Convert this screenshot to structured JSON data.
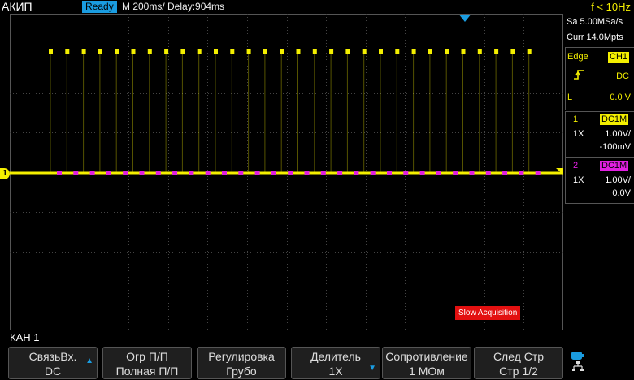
{
  "header": {
    "brand": "АКИП",
    "status": "Ready",
    "timebase": "M 200ms/  Delay:904ms",
    "frequency": "f < 10Hz"
  },
  "acquisition": {
    "sample_rate": "Sa 5.00MSa/s",
    "memory_depth": "Curr 14.0Mpts"
  },
  "trigger": {
    "type": "Edge",
    "source": "CH1",
    "slope_icon": "rising-edge-icon",
    "coupling": "DC",
    "level_label": "L",
    "level": "0.0 V"
  },
  "channels": [
    {
      "num": "1",
      "tag": "DC1M",
      "probe": "1X",
      "scale": "1.00V/",
      "offset": "-100mV",
      "color": "#f4ef00"
    },
    {
      "num": "2",
      "tag": "DC1M",
      "probe": "1X",
      "scale": "1.00V/",
      "offset": "0.0V",
      "color": "#e020e0"
    }
  ],
  "screen": {
    "ch1_marker": "1",
    "slow_acquisition": "Slow Acquisition"
  },
  "menu": {
    "title": "КАН 1",
    "softkeys": [
      {
        "line1": "СвязьВх.",
        "line2": "DC",
        "has_arrow": true
      },
      {
        "line1": "Огр П/П",
        "line2": "Полная П/П",
        "has_arrow": false
      },
      {
        "line1": "Регулировка",
        "line2": "Грубо",
        "has_arrow": false
      },
      {
        "line1": "Делитель",
        "line2": "1X",
        "has_arrow": true
      },
      {
        "line1": "Сопротивление",
        "line2": "1 МОм",
        "has_arrow": false
      },
      {
        "line1": "След Стр",
        "line2": "Стр 1/2",
        "has_arrow": false
      }
    ],
    "tray_icons": [
      "battery-icon",
      "network-icon"
    ]
  },
  "colors": {
    "ch1": "#f4ef00",
    "ch2": "#e020e0",
    "accent": "#1a9ce0",
    "alert": "#e31010"
  }
}
